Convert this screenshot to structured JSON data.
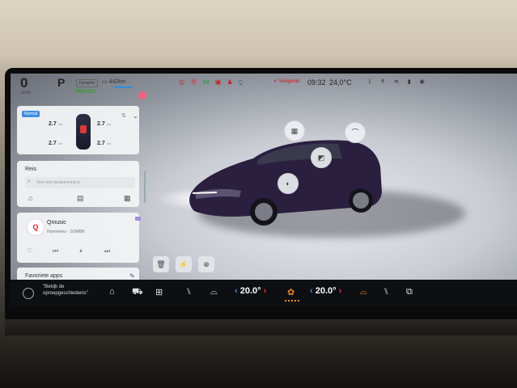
{
  "status": {
    "speed": "0",
    "speed_unit": "km/h",
    "gear": "P",
    "drive_mode": "Dynamic",
    "ready": "READY",
    "range": "442km",
    "safety_label": "Veiligheid",
    "time": "09:32",
    "outside_temp": "24,0°C"
  },
  "tire_card": {
    "tag": "Normal",
    "front_left": "2.7",
    "front_right": "2.7",
    "rear_left": "2.7",
    "rear_right": "2.7",
    "unit": "bar"
  },
  "route_card": {
    "title": "Reis",
    "search_placeholder": "Voer een bestemming in"
  },
  "music_card": {
    "logo": "Q",
    "station": "Qmusic",
    "track": "Hommeles - SOMBR"
  },
  "favorites_card": {
    "title": "Favoriete apps"
  },
  "bottom_bar": {
    "call_label": "\"Bekijk de oproepgeschiedenis\"",
    "temp_left": "20.0°",
    "temp_right": "20.0°"
  },
  "icons": {
    "home": "home-icon",
    "car": "car-icon",
    "apps": "grid-icon",
    "seat_heat_left": "seat-heat-icon",
    "defrost_front": "defrost-icon",
    "fan": "fan-icon",
    "defrost_rear": "rear-defrost-icon",
    "seat_heat_right": "seat-heat-icon",
    "mirror": "screen-mirror-icon"
  }
}
